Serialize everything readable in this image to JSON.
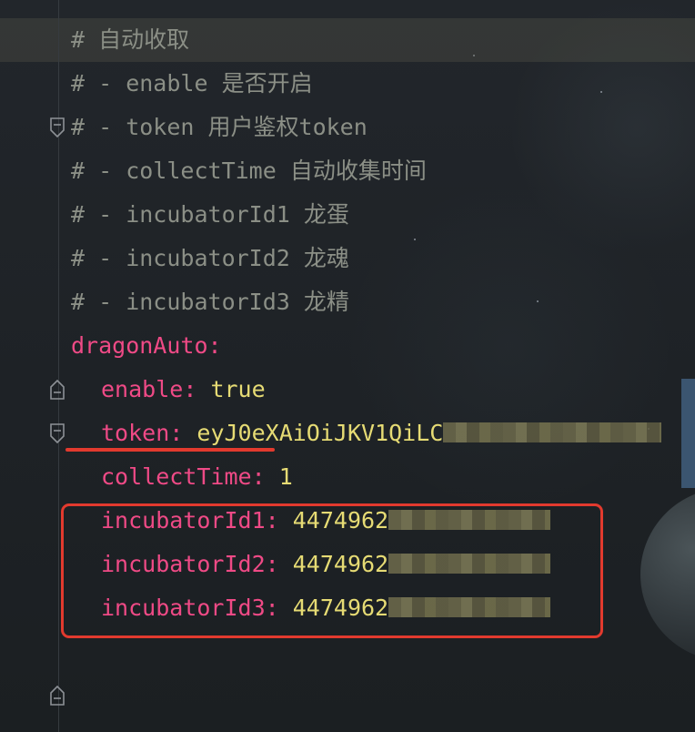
{
  "editor": {
    "lines": [
      {
        "text": "# 自动收取"
      },
      {
        "text": "# - enable 是否开启"
      },
      {
        "text": "# - token 用户鉴权token"
      },
      {
        "text": "# - collectTime 自动收集时间"
      },
      {
        "text": "# - incubatorId1 龙蛋"
      },
      {
        "text": "# - incubatorId2 龙魂"
      },
      {
        "text": "# - incubatorId3 龙精"
      }
    ],
    "yaml": {
      "root_key": "dragonAuto",
      "colon": ":",
      "enable": {
        "key": "enable",
        "value": "true"
      },
      "token": {
        "key": "token",
        "value": "eyJ0eXAiOiJKV1QiLC"
      },
      "collectTime": {
        "key": "collectTime",
        "value": "1"
      },
      "incubatorId1": {
        "key": "incubatorId1",
        "value": "4474962"
      },
      "incubatorId2": {
        "key": "incubatorId2",
        "value": "4474962"
      },
      "incubatorId3": {
        "key": "incubatorId3",
        "value": "4474962"
      }
    }
  },
  "colors": {
    "comment": "#8b8f86",
    "key": "#ef4a86",
    "value": "#e6db74",
    "annotation": "#e23a2e",
    "background": "#1f2226"
  }
}
